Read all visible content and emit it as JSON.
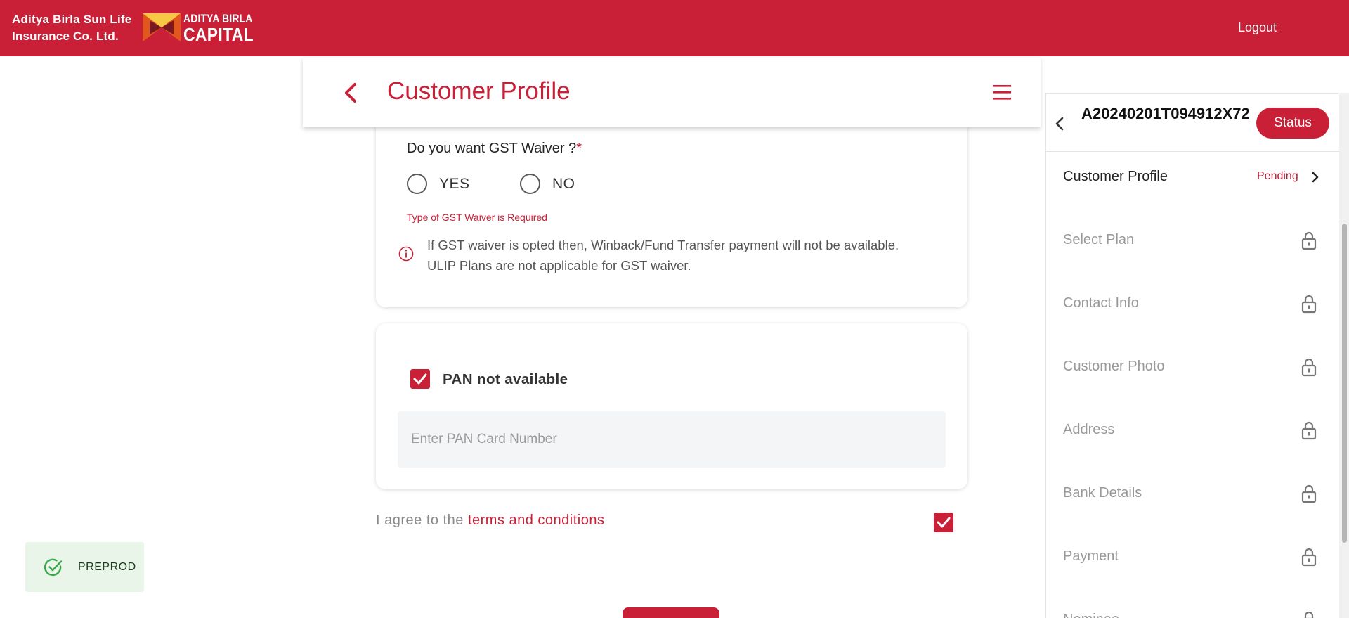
{
  "header": {
    "brand_line1": "Aditya Birla Sun Life",
    "brand_line2": "Insurance Co. Ltd.",
    "logo_line1": "ADITYA BIRLA",
    "logo_line2": "CAPITAL",
    "logout": "Logout",
    "brand_color": "#c91f37"
  },
  "page": {
    "title": "Customer Profile",
    "back_icon": "chevron-left-icon",
    "menu_icon": "hamburger-menu-icon"
  },
  "gst": {
    "question": "Do you want GST Waiver ?",
    "required_mark": "*",
    "options": [
      "YES",
      "NO"
    ],
    "error": "Type of GST Waiver is Required",
    "info_line1": "If GST waiver is opted then, Winback/Fund Transfer payment will not be available.",
    "info_line2": "ULIP Plans are not applicable for GST waiver."
  },
  "pan": {
    "checkbox_label": "PAN not available",
    "checked": true,
    "placeholder": "Enter PAN Card Number",
    "value": ""
  },
  "terms": {
    "prefix": "I agree to the",
    "link": "terms and conditions",
    "checked": true
  },
  "toast": {
    "text": "PREPROD",
    "icon": "check-circle-icon"
  },
  "sidebar": {
    "application_id": "A20240201T094912X72",
    "status_button": "Status",
    "steps": [
      {
        "label": "Customer Profile",
        "state": "Pending",
        "active": true
      },
      {
        "label": "Select Plan",
        "state": "locked"
      },
      {
        "label": "Contact Info",
        "state": "locked"
      },
      {
        "label": "Customer Photo",
        "state": "locked"
      },
      {
        "label": "Address",
        "state": "locked"
      },
      {
        "label": "Bank Details",
        "state": "locked"
      },
      {
        "label": "Payment",
        "state": "locked"
      },
      {
        "label": "Nominee",
        "state": "locked"
      }
    ]
  }
}
